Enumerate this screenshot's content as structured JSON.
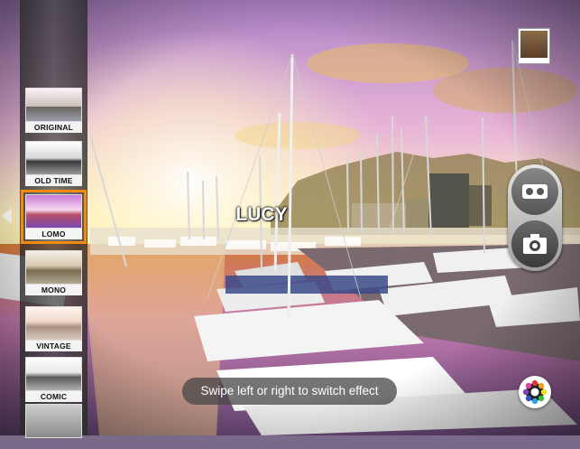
{
  "filters": [
    {
      "label": "ORIGINAL"
    },
    {
      "label": "OLD TIME"
    },
    {
      "label": "LOMO",
      "selected": true
    },
    {
      "label": "MONO"
    },
    {
      "label": "VINTAGE"
    },
    {
      "label": "COMIC"
    },
    {
      "label": ""
    }
  ],
  "current_effect": "LUCY",
  "hint": "Swipe left or right to switch effect",
  "icons": {
    "gallery": "gallery-thumbnail-icon",
    "video": "video-camera-icon",
    "photo": "photo-camera-icon",
    "effects": "color-palette-icon",
    "strip_arrow": "triangle-left-icon"
  },
  "colors": {
    "selection": "#f28a12",
    "sky_top": "#b084c8",
    "sky_glow": "#fff4b8"
  }
}
